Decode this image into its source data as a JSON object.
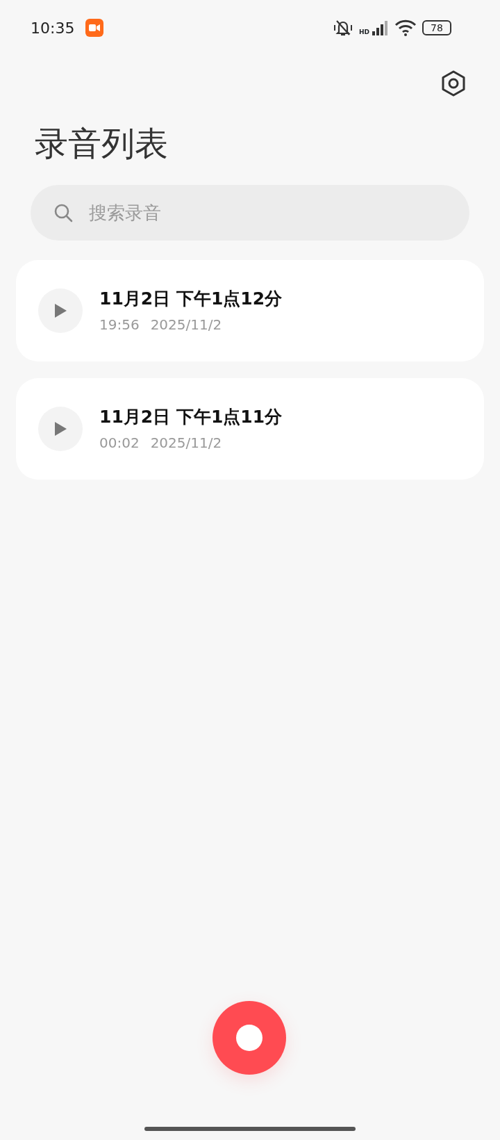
{
  "status_bar": {
    "time": "10:35",
    "network_label": "HD",
    "battery": "78"
  },
  "header": {
    "title": "录音列表"
  },
  "search": {
    "placeholder": "搜索录音"
  },
  "recordings": [
    {
      "title": "11月2日 下午1点12分",
      "duration": "19:56",
      "date": "2025/11/2"
    },
    {
      "title": "11月2日 下午1点11分",
      "duration": "00:02",
      "date": "2025/11/2"
    }
  ]
}
